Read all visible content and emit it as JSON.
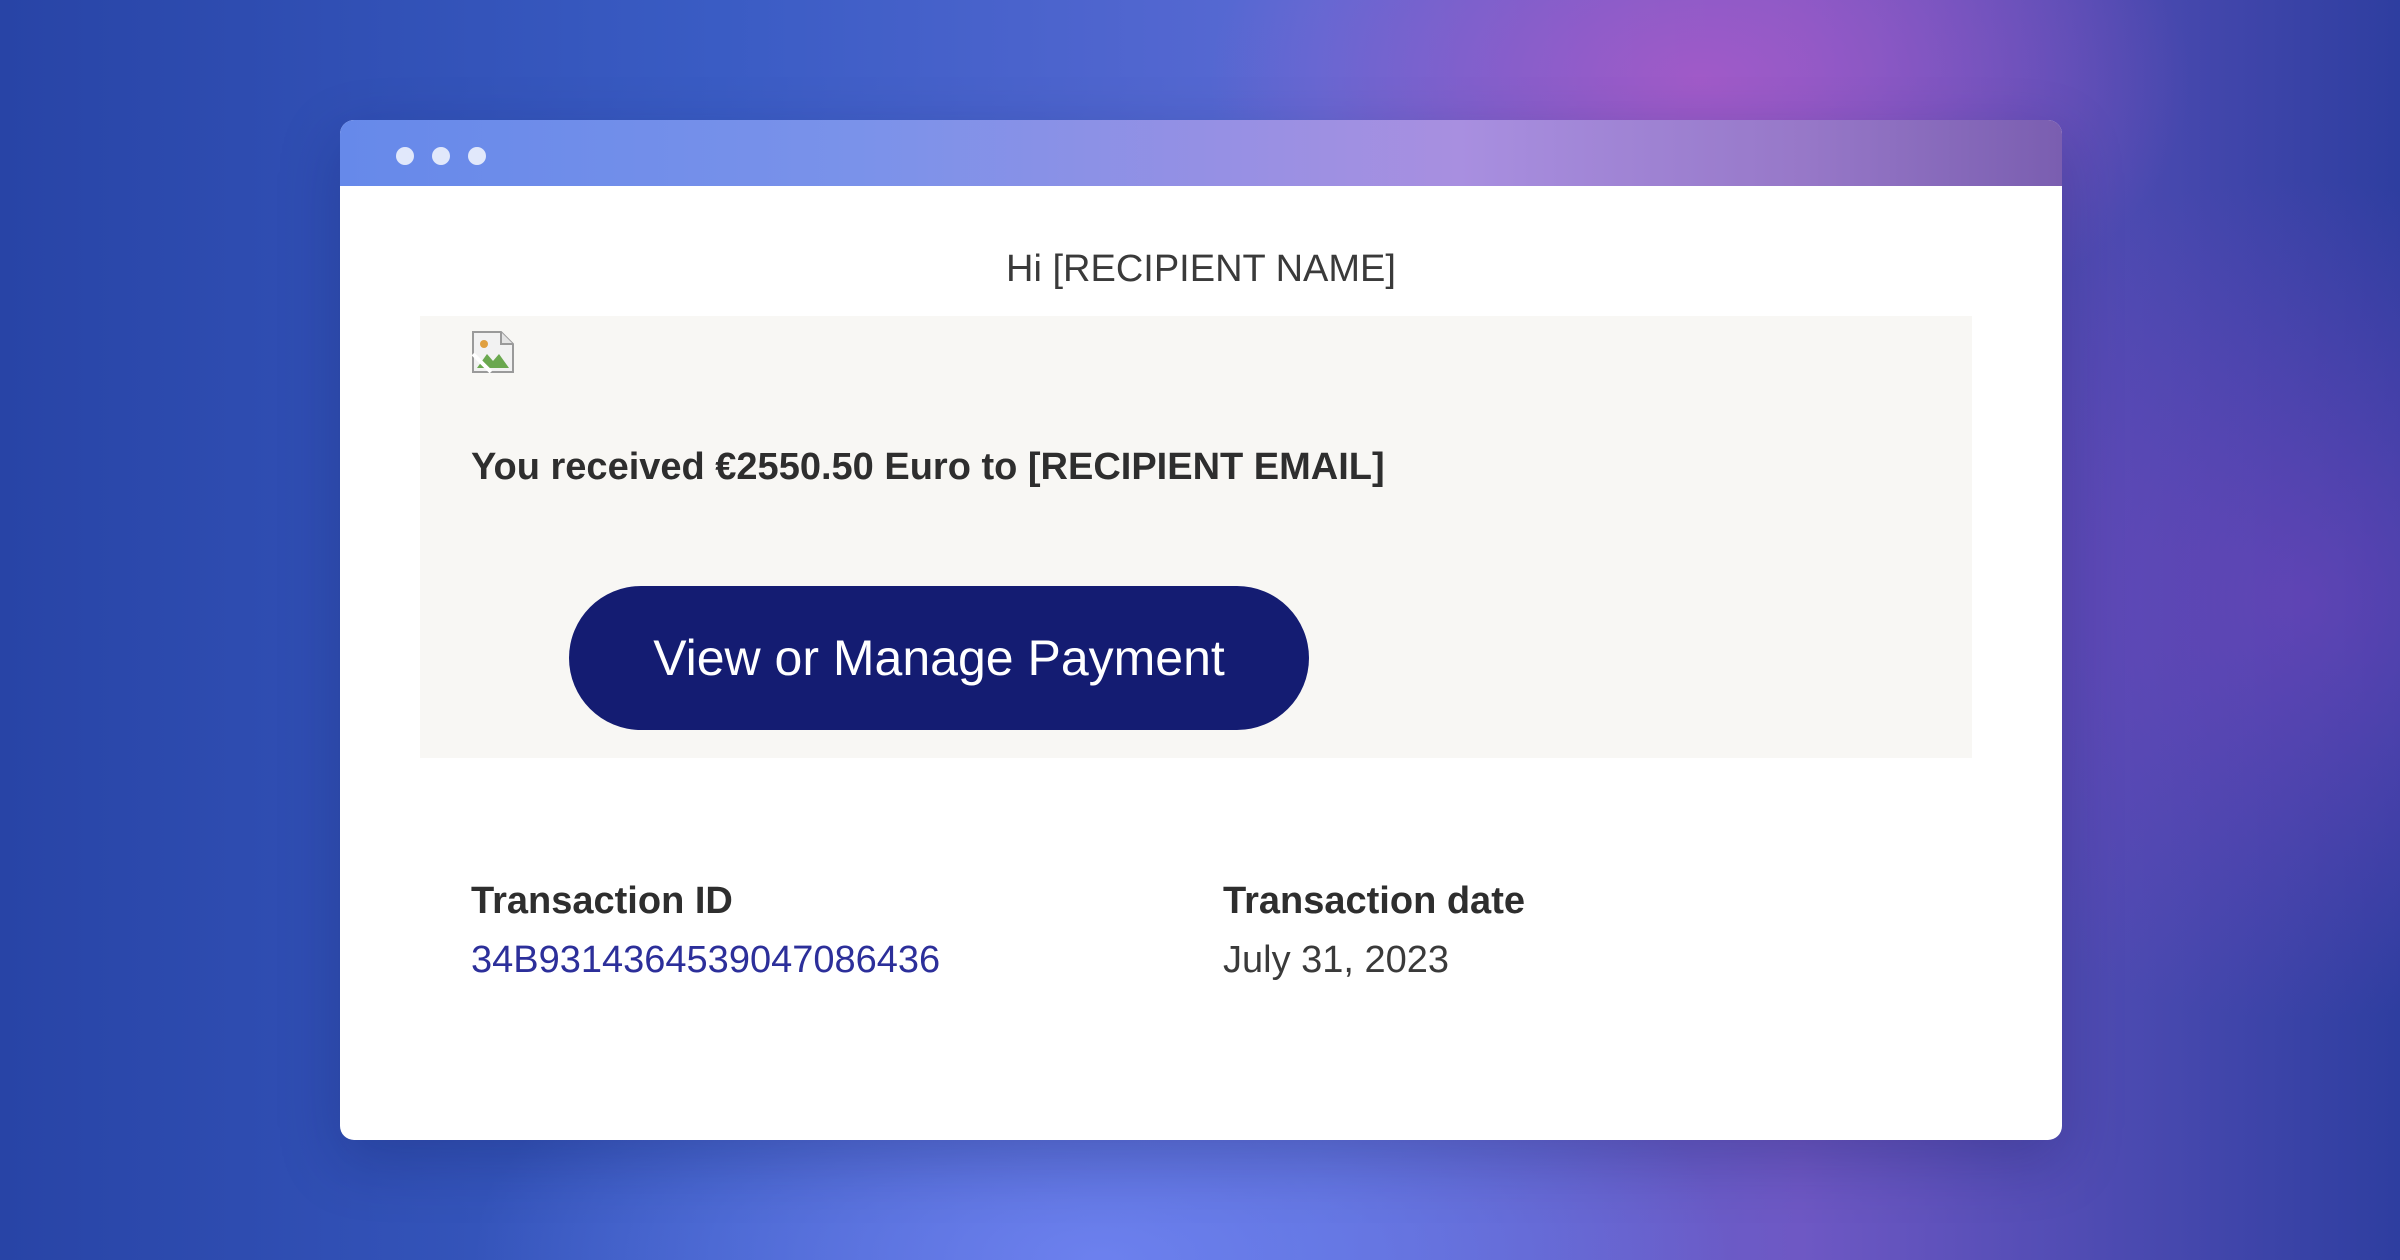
{
  "window": {
    "titlebar_dots": 3
  },
  "email": {
    "greeting": "Hi [RECIPIENT NAME]",
    "card": {
      "image_alt": "broken-image",
      "amount_text": "You received €2550.50 Euro to [RECIPIENT EMAIL]",
      "button_label": "View or Manage Payment"
    },
    "details": {
      "transaction_id_label": "Transaction ID",
      "transaction_id_value": "34B9314364539047086436",
      "transaction_date_label": "Transaction date",
      "transaction_date_value": "July 31, 2023"
    }
  },
  "colors": {
    "button_bg": "#141c72",
    "link": "#2c2f9a",
    "card_bg": "#f8f7f4"
  }
}
